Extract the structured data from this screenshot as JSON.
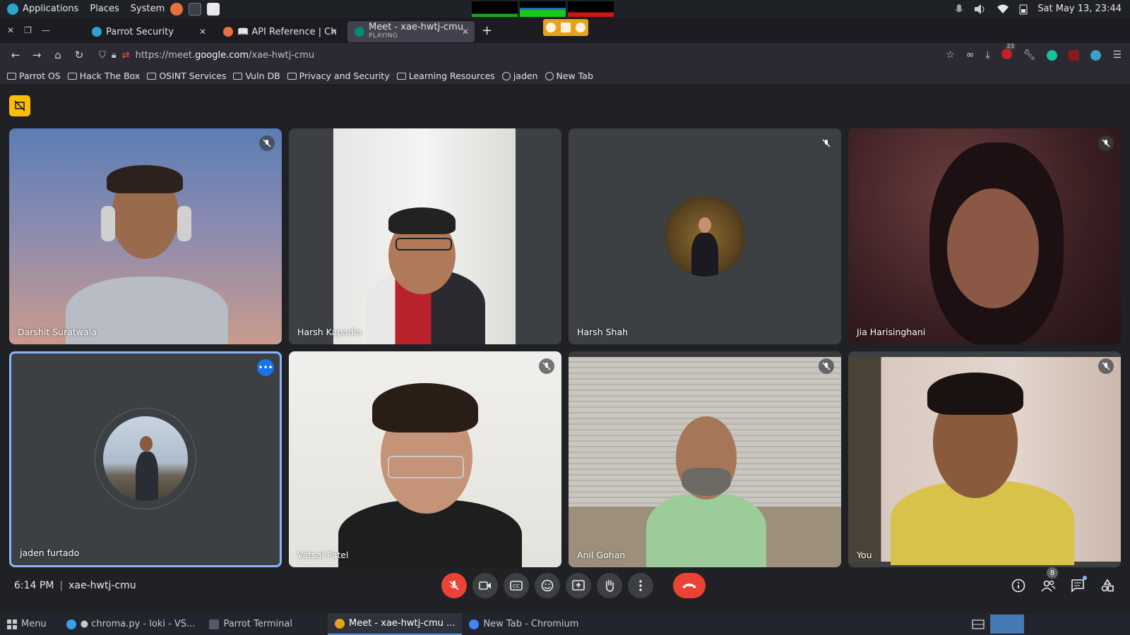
{
  "system_bar": {
    "menu_applications": "Applications",
    "menu_places": "Places",
    "menu_system": "System",
    "datetime": "Sat May 13, 23:44"
  },
  "tabs": [
    {
      "label": "Parrot Security",
      "favicon_color": "#2aa6c8"
    },
    {
      "label": "📖 API Reference | Chrom",
      "favicon_color": "#e8703a"
    },
    {
      "label": "Meet - xae-hwtj-cmu",
      "sub": "PLAYING",
      "favicon_color": "#00897b"
    }
  ],
  "navbar": {
    "url_prefix": "https://meet.",
    "url_domain": "google.com",
    "url_path": "/xae-hwtj-cmu",
    "notification_count": "23"
  },
  "bookmarks": [
    {
      "label": "Parrot OS",
      "icon": "folder-icon"
    },
    {
      "label": "Hack The Box",
      "icon": "folder-icon"
    },
    {
      "label": "OSINT Services",
      "icon": "folder-icon"
    },
    {
      "label": "Vuln DB",
      "icon": "folder-icon"
    },
    {
      "label": "Privacy and Security",
      "icon": "folder-icon"
    },
    {
      "label": "Learning Resources",
      "icon": "folder-icon"
    },
    {
      "label": "jaden",
      "icon": "globe-icon"
    },
    {
      "label": "New Tab",
      "icon": "globe-icon"
    }
  ],
  "participants": [
    {
      "name": "Darshit Suratwala",
      "muted": true
    },
    {
      "name": "Harsh Kapadia",
      "muted": false
    },
    {
      "name": "Harsh Shah",
      "muted": true
    },
    {
      "name": "Jia Harisinghani",
      "muted": true
    },
    {
      "name": "jaden furtado",
      "muted": false
    },
    {
      "name": "Vatsal Patel",
      "muted": true
    },
    {
      "name": "Anil Gohan",
      "muted": true
    },
    {
      "name": "You",
      "muted": true
    }
  ],
  "meeting": {
    "time": "6:14 PM",
    "separator": "|",
    "code": "xae-hwtj-cmu",
    "people_count": "8"
  },
  "taskbar": {
    "menu": "Menu",
    "items": [
      {
        "label": "● chroma.py - loki - VS...",
        "color": "#3aa0e8"
      },
      {
        "label": "Parrot Terminal",
        "color": "#555b66"
      },
      {
        "label": "Meet - xae-hwtj-cmu ...",
        "color": "#e8a21a"
      },
      {
        "label": "New Tab - Chromium",
        "color": "#4285f4"
      }
    ]
  },
  "colors": {
    "accent": "#8ab4f8",
    "hangup": "#ea4335",
    "present_button": "#fbbc04"
  }
}
